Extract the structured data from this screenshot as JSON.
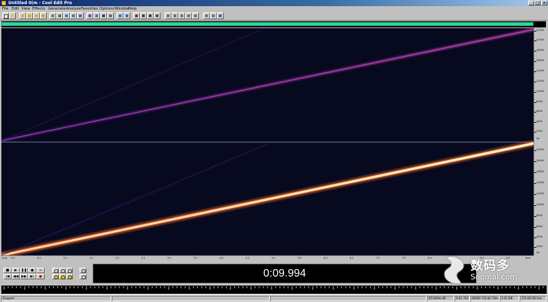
{
  "window": {
    "title": "Untitled 0(m - Cool Edit Pro",
    "minimize_glyph": "_",
    "maximize_glyph": "□",
    "close_glyph": "×"
  },
  "menu": [
    "File",
    "Edit",
    "View",
    "Effects",
    "Generate",
    "Analyze",
    "Favorites",
    "Options",
    "Window",
    "Help"
  ],
  "toolbar": {
    "icons": [
      "new-icon",
      "open-icon",
      "save-icon",
      "cut-icon",
      "copy-icon",
      "paste-icon",
      "mix-paste-icon",
      "undo-icon",
      "repeat-icon",
      "play-icon",
      "loop-icon",
      "spectral-view-icon",
      "waveform-view-icon",
      "zoom-icon",
      "select-icon",
      "snap-icon",
      "grid-icon",
      "marker-icon",
      "cue-icon",
      "meter-icon",
      "settings-icon",
      "help-icon"
    ]
  },
  "time_display": "0:09.994",
  "hz_ruler": {
    "top_labels": [
      "22000",
      "20000",
      "18000",
      "16000",
      "14000",
      "12000",
      "10000",
      "8000",
      "6000",
      "4000",
      "2000",
      "Hz"
    ],
    "bottom_labels": [
      "20000",
      "18000",
      "16000",
      "14000",
      "12000",
      "10000",
      "8000",
      "6000",
      "4000",
      "2000",
      "Hz"
    ]
  },
  "time_ruler": [
    "hms",
    "0.0",
    "0.5",
    "1.0",
    "1.5",
    "2.0",
    "2.5",
    "3.0",
    "3.5",
    "4.0",
    "4.5",
    "5.0",
    "5.5",
    "6.0",
    "6.5",
    "7.0",
    "7.5",
    "8.0",
    "8.5",
    "9.0",
    "9.5",
    "hms"
  ],
  "transport": {
    "row1": [
      "■",
      "▶",
      "❚❚",
      "●",
      "∞"
    ],
    "row2": [
      "|◀",
      "◀◀",
      "▶▶",
      "▶|",
      "●"
    ]
  },
  "zoom_buttons": [
    "zoom-in-h-icon",
    "zoom-out-h-icon",
    "zoom-full-icon",
    "zoom-in-v-icon",
    "zoom-out-v-icon",
    "zoom-left-icon",
    "zoom-right-icon",
    "zoom-sel-icon"
  ],
  "status": [
    "Stopped",
    "",
    "",
    "95348Hz-dB",
    "0:01.764",
    "96000 ?32-bit ?Stereo",
    "3.41 MB",
    "374.08 GB free"
  ],
  "watermark": {
    "cn": "数码多",
    "en": "Soomal.com"
  },
  "colors": {
    "title_start": "#0a246a",
    "spectrum_bg": "#070a1e",
    "overview_bar": "#33d6a0",
    "upper_sweep": "#9c2ea8",
    "lower_sweep": "#ffe7a0"
  }
}
